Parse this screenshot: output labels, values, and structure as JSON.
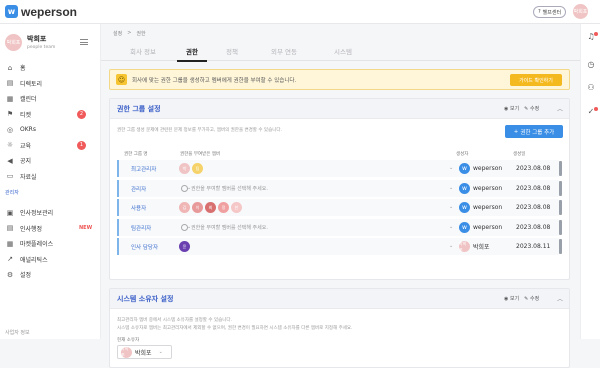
{
  "app": {
    "logo_text": "weperson",
    "logo_mark": "w",
    "help_label": "헬프센터",
    "user_avatar_text": "박희포"
  },
  "profile": {
    "avatar_text": "박희포",
    "name": "박희포",
    "role": "people team"
  },
  "nav": [
    {
      "icon": "home-icon",
      "glyph": "⌂",
      "label": "홈"
    },
    {
      "icon": "directory-icon",
      "glyph": "▤",
      "label": "디렉토리"
    },
    {
      "icon": "calendar-icon",
      "glyph": "▦",
      "label": "캘린더"
    },
    {
      "icon": "flag-icon",
      "glyph": "⚑",
      "label": "티켓",
      "badge": "2"
    },
    {
      "icon": "target-icon",
      "glyph": "◎",
      "label": "OKRs"
    },
    {
      "icon": "bulb-icon",
      "glyph": "☼",
      "label": "교육",
      "badge": "1"
    },
    {
      "icon": "megaphone-icon",
      "glyph": "◀",
      "label": "공지"
    },
    {
      "icon": "folder-icon",
      "glyph": "▭",
      "label": "자료실"
    }
  ],
  "admin_section": "관리자",
  "admin_nav": [
    {
      "icon": "hr-info-icon",
      "glyph": "▣",
      "label": "인사정보관리"
    },
    {
      "icon": "hr-process-icon",
      "glyph": "▤",
      "label": "인사행정",
      "new": "NEW"
    },
    {
      "icon": "market-icon",
      "glyph": "▦",
      "label": "마켓플레이스"
    },
    {
      "icon": "analytics-icon",
      "glyph": "↗",
      "label": "애널리틱스"
    },
    {
      "icon": "settings-icon",
      "glyph": "⚙",
      "label": "설정"
    }
  ],
  "side_footer": "사업자 정보",
  "breadcrumb": {
    "first": "설정",
    "sep": ">",
    "second": "권한"
  },
  "tabs": [
    "회사 정보",
    "권한",
    "정책",
    "외부 연동",
    "시스템"
  ],
  "active_tab": 1,
  "notice": {
    "emoji": "☺",
    "text": "회사에 맞는 권한 그룹을 생성하고 멤버에게 권한을 부여할 수 있습니다.",
    "button": "가이드 확인하기"
  },
  "permission_panel": {
    "title": "권한 그룹 설정",
    "view_label": "보기",
    "edit_label": "수정",
    "caret": "︿",
    "desc": "권한 그룹 생성 문제에 관련된 문제 정보를 부가하고, 멤버의 권한을 변경할 수 있습니다.",
    "add_button": "권한 그룹 추가",
    "add_plus": "+",
    "headers": {
      "group": "권한 그룹 명",
      "members": "권한을 부여받은 멤버",
      "creator": "생성자",
      "date": "생성일"
    },
    "rows": [
      {
        "name": "최고관리자",
        "members": [
          {
            "text": "박",
            "color": "#f0c4c4"
          },
          {
            "text": "팀",
            "color": "#f5d36a"
          }
        ],
        "placeholder": "",
        "creator": "weperson",
        "creator_type": "logo",
        "date": "2023.08.08"
      },
      {
        "name": "관리자",
        "members": [],
        "placeholder": "권한을 부여할 멤버를 선택해 주세요.",
        "creator": "weperson",
        "creator_type": "logo",
        "date": "2023.08.08"
      },
      {
        "name": "사용자",
        "members": [
          {
            "text": "김",
            "color": "#f0b6b6"
          },
          {
            "text": "이",
            "color": "#e89a9a"
          },
          {
            "text": "최",
            "color": "#d97070"
          },
          {
            "text": "정",
            "color": "#f0a0a0"
          },
          {
            "text": "한",
            "color": "#f5c7c7"
          }
        ],
        "placeholder": "",
        "creator": "weperson",
        "creator_type": "logo",
        "date": "2023.08.08"
      },
      {
        "name": "팀관리자",
        "members": [],
        "placeholder": "권한을 부여할 멤버를 선택해 주세요.",
        "creator": "weperson",
        "creator_type": "logo",
        "date": "2023.08.08"
      },
      {
        "name": "인사 담당자",
        "members": [
          {
            "text": "윤",
            "color": "#6a3fb0"
          }
        ],
        "placeholder": "",
        "creator": "박희포",
        "creator_type": "avatar",
        "date": "2023.08.11"
      }
    ]
  },
  "owner_panel": {
    "title": "시스템 소유자 설정",
    "view_label": "보기",
    "edit_label": "수정",
    "caret": "︿",
    "desc1": "최고관리자 멤버 중에서 시스템 소유자를 설정할 수 있습니다.",
    "desc2": "시스템 소유자로 멤버는 최고관리자에서 제외할 수 없으며, 권한 변경이 필요하면 시스템 소유자를 다른 멤버로 지정해 주세요.",
    "owner_label": "현재 소유자",
    "owner_name": "박희포",
    "owner_avatar": "박희포"
  }
}
